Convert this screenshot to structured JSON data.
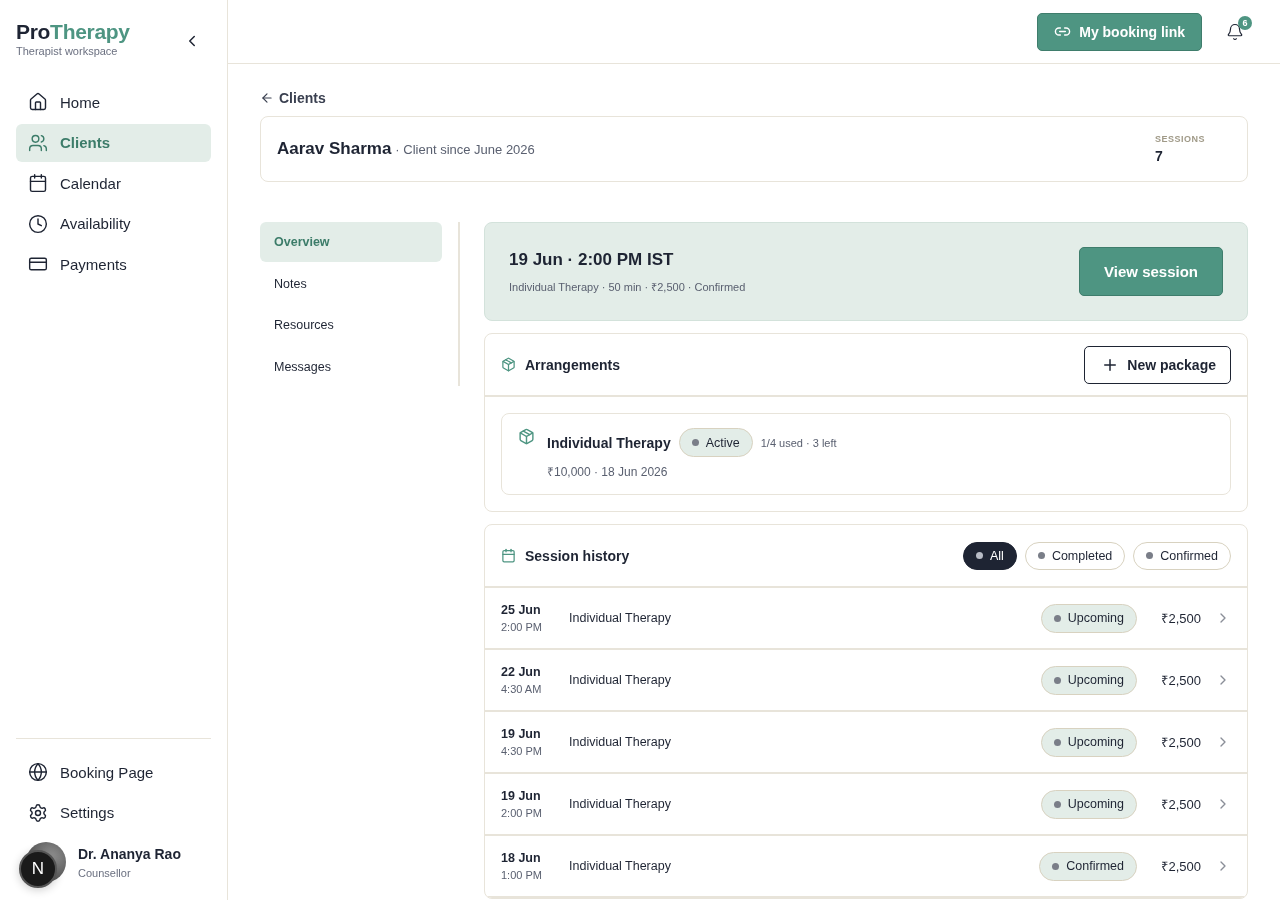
{
  "brand": {
    "part_1": "Pro",
    "part_2": "Therapy",
    "subtitle": "Therapist workspace"
  },
  "nav": [
    {
      "kind": "home",
      "label": "Home",
      "selected": false
    },
    {
      "kind": "clients",
      "label": "Clients",
      "selected": true
    },
    {
      "kind": "calendar",
      "label": "Calendar",
      "selected": false
    },
    {
      "kind": "availability",
      "label": "Availability",
      "selected": false
    },
    {
      "kind": "payments",
      "label": "Payments",
      "selected": false
    }
  ],
  "nav_bottom": [
    {
      "kind": "globe",
      "label": "Booking Page"
    },
    {
      "kind": "settings",
      "label": "Settings"
    }
  ],
  "user": {
    "name": "Dr. Ananya Rao",
    "role": "Counsellor",
    "dev_badge": "N"
  },
  "topbar": {
    "booking_link": "My booking link",
    "notifications": "6"
  },
  "back": "Clients",
  "client": {
    "name": "Aarav Sharma",
    "since": "· Client since June 2026",
    "sessions_label": "SESSIONS",
    "sessions": "7"
  },
  "subnav": [
    {
      "label": "Overview",
      "selected": true
    },
    {
      "label": "Notes",
      "selected": false
    },
    {
      "label": "Resources",
      "selected": false
    },
    {
      "label": "Messages",
      "selected": false
    }
  ],
  "next_session": {
    "title": "19 Jun · 2:00 PM IST",
    "details": "Individual Therapy · 50 min · ₹2,500 · Confirmed",
    "button": "View session"
  },
  "arrangements": {
    "title": "Arrangements",
    "button": "New package",
    "packages": [
      {
        "name": "Individual Therapy",
        "status": "Active",
        "usage": "1/4 used · 3 left",
        "details": "₹10,000 · 18 Jun 2026"
      }
    ]
  },
  "history": {
    "title": "Session history",
    "filters": [
      {
        "label": "All",
        "selected": true
      },
      {
        "label": "Completed",
        "selected": false
      },
      {
        "label": "Confirmed",
        "selected": false
      }
    ],
    "rows": [
      {
        "date": "25 Jun",
        "time": "2:00 PM",
        "type": "Individual Therapy",
        "status": "Upcoming",
        "price": "₹2,500"
      },
      {
        "date": "22 Jun",
        "time": "4:30 AM",
        "type": "Individual Therapy",
        "status": "Upcoming",
        "price": "₹2,500"
      },
      {
        "date": "19 Jun",
        "time": "4:30 PM",
        "type": "Individual Therapy",
        "status": "Upcoming",
        "price": "₹2,500"
      },
      {
        "date": "19 Jun",
        "time": "2:00 PM",
        "type": "Individual Therapy",
        "status": "Upcoming",
        "price": "₹2,500"
      },
      {
        "date": "18 Jun",
        "time": "1:00 PM",
        "type": "Individual Therapy",
        "status": "Confirmed",
        "price": "₹2,500"
      }
    ]
  }
}
